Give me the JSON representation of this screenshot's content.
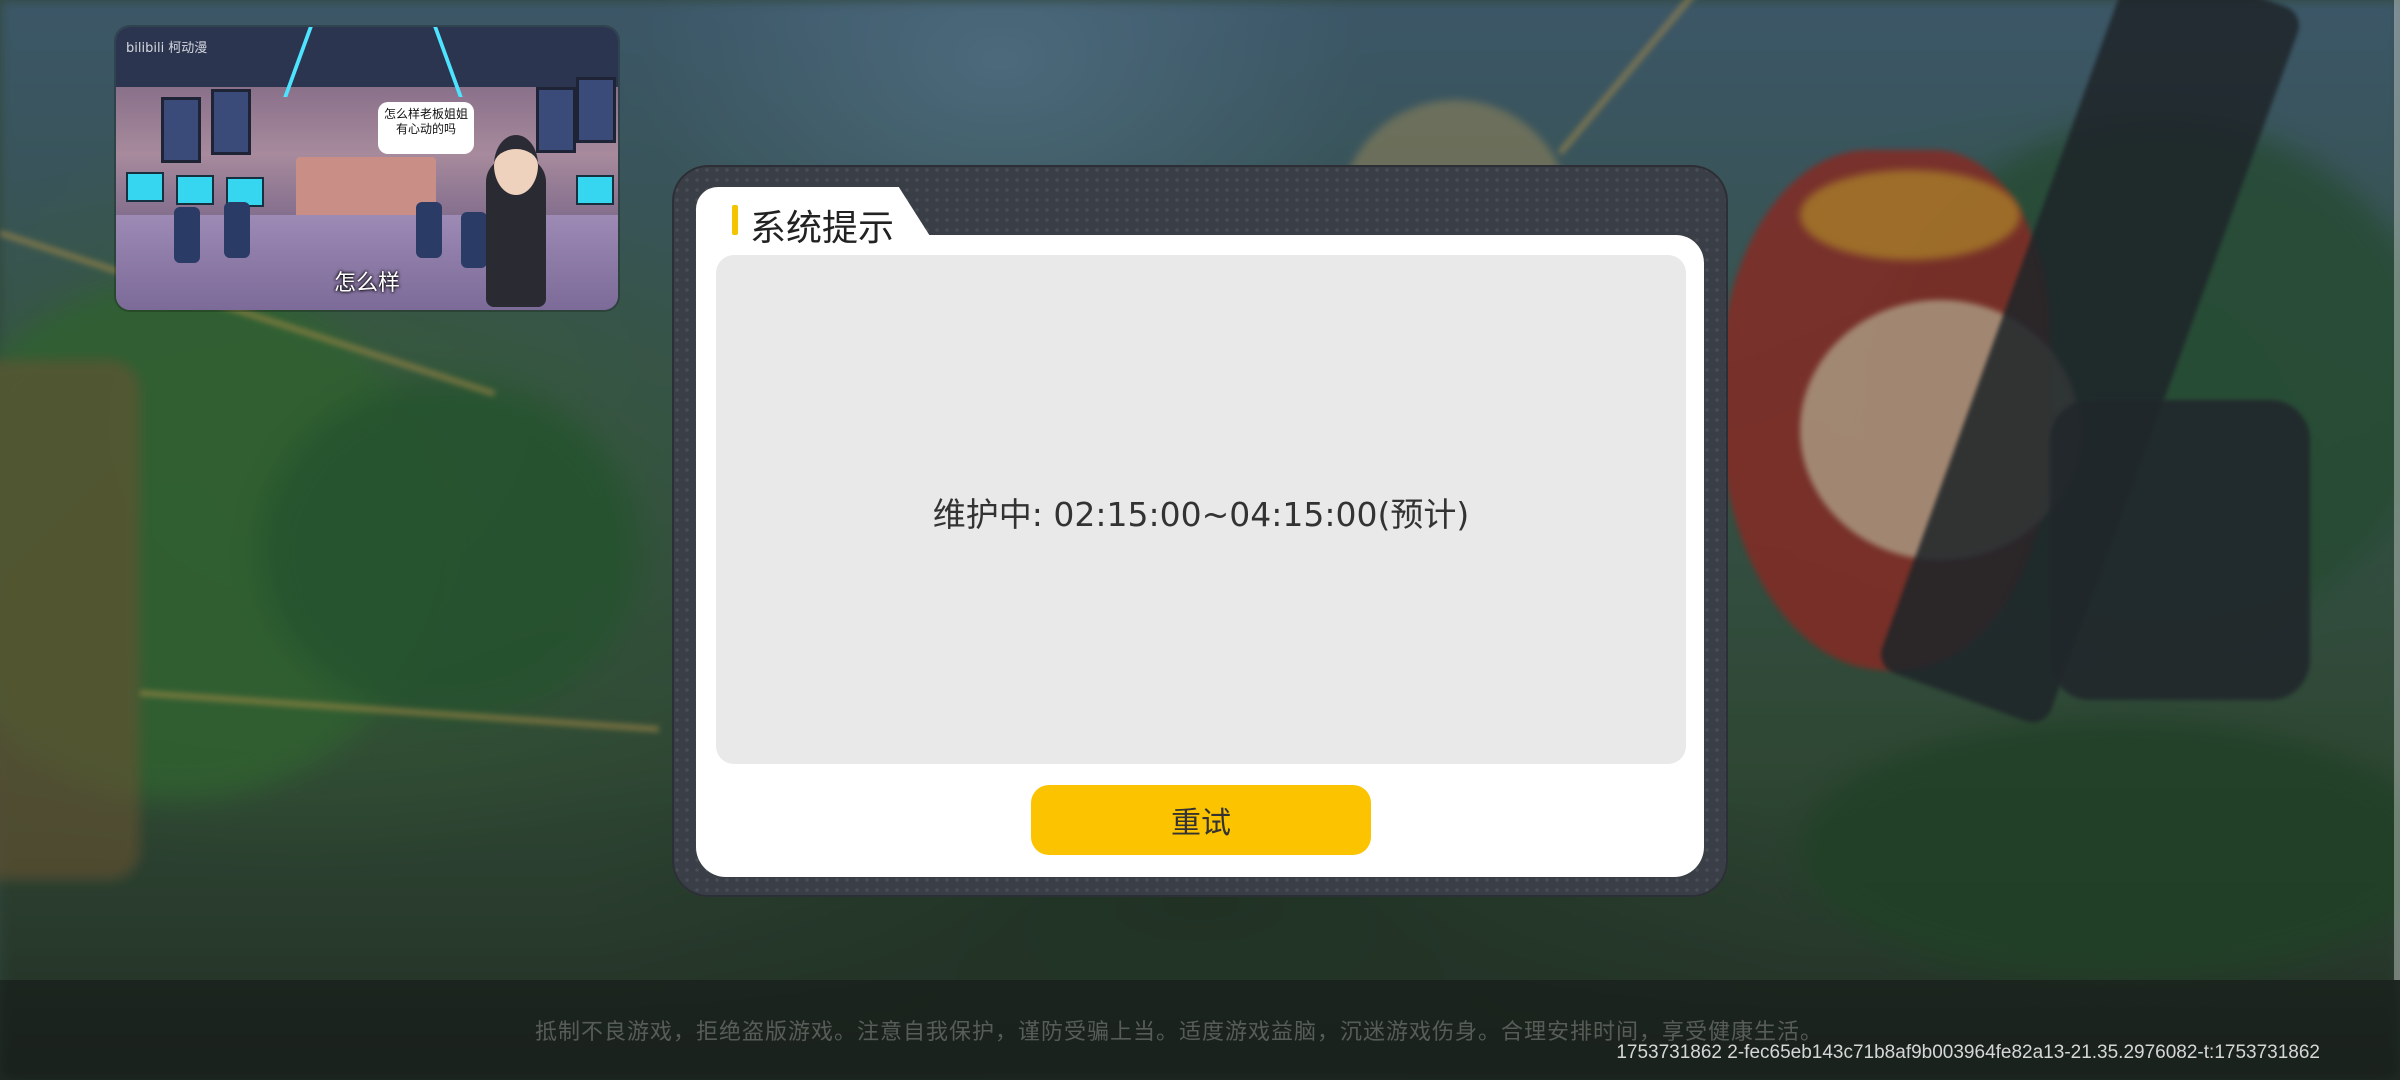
{
  "dialog": {
    "title": "系统提示",
    "message": "维护中: 02:15:00~04:15:00(预计)",
    "retry_label": "重试"
  },
  "video_overlay": {
    "watermark": "bilibili 柯动漫",
    "bubble_line1": "怎么样老板姐姐",
    "bubble_line2": "有心动的吗",
    "subtitle": "怎么样"
  },
  "footer": {
    "notice": "抵制不良游戏，拒绝盗版游戏。注意自我保护，谨防受骗上当。适度游戏益脑，沉迷游戏伤身。合理安排时间，享受健康生活。",
    "version": "1753731862  2-fec65eb143c71b8af9b003964fe82a13-21.35.2976082-t:1753731862"
  },
  "colors": {
    "accent": "#f5c300",
    "button": "#fbc300",
    "dialog_frame": "#3a3e46",
    "content_bg": "#e8e9e8"
  }
}
